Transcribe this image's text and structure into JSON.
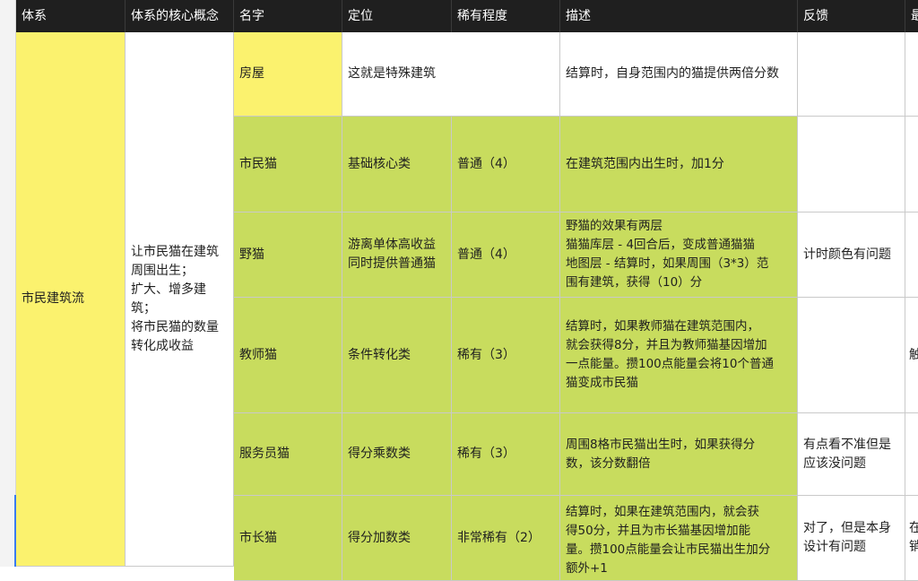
{
  "headers": [
    "体系",
    "体系的核心概念",
    "名字",
    "定位",
    "稀有程度",
    "描述",
    "反馈",
    "最"
  ],
  "system": "市民建筑流",
  "core_concept": "让市民猫在建筑\n周围出生；\n扩大、增多建\n筑；\n将市民猫的数量\n转化成收益",
  "rows": [
    {
      "name": "房屋",
      "position": "这就是特殊建筑",
      "rarity": "",
      "desc": "结算时，自身范围内的猫提供两倍分数",
      "feedback": "",
      "extra": ""
    },
    {
      "name": "市民猫",
      "position": "基础核心类",
      "rarity": "普通（4）",
      "desc": "在建筑范围内出生时，加1分",
      "feedback": "",
      "extra": ""
    },
    {
      "name": "野猫",
      "position": "游离单体高收益\n同时提供普通猫",
      "rarity": "普通（4）",
      "desc": "野猫的效果有两层\n猫猫库层 - 4回合后，变成普通猫猫\n地图层 - 结算时，如果周围（3*3）范\n围有建筑，获得（10）分",
      "feedback": "计时颜色有问题",
      "extra": ""
    },
    {
      "name": "教师猫",
      "position": "条件转化类",
      "rarity": "稀有（3）",
      "desc": "结算时，如果教师猫在建筑范围内，\n就会获得8分，并且为教师猫基因增加\n一点能量。攒100点能量会将10个普通\n猫变成市民猫",
      "feedback": "",
      "extra": "触"
    },
    {
      "name": "服务员猫",
      "position": "得分乘数类",
      "rarity": "稀有（3）",
      "desc": "周围8格市民猫出生时，如果获得分\n数，该分数翻倍",
      "feedback": "有点看不准但是\n应该没问题",
      "extra": ""
    },
    {
      "name": "市长猫",
      "position": "得分加数类",
      "rarity": "非常稀有（2）",
      "desc": "结算时，如果在建筑范围内，就会获\n得50分，并且为市长猫基因增加能\n量。攒100点能量会让市民猫出生加分\n额外+1",
      "feedback": "对了，但是本身\n设计有问题",
      "extra": "在\n销"
    }
  ]
}
